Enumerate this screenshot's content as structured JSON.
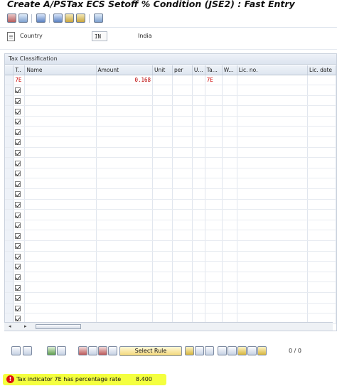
{
  "window": {
    "title": "Create A/PSTax ECS Setoff % Condition (JSE2) : Fast Entry"
  },
  "toolbar": {
    "icons": [
      "execute-icon",
      "variants-icon",
      "display-icon",
      "info-icon",
      "hierarchy-icon",
      "key-icon",
      "other-icon"
    ]
  },
  "country": {
    "label": "Country",
    "code": "IN",
    "name": "India"
  },
  "panel": {
    "title": "Tax Classification"
  },
  "table": {
    "columns": [
      "T..",
      "Name",
      "Amount",
      "Unit",
      "per",
      "U...",
      "Ta...",
      "W...",
      "Lic. no.",
      "Lic. date"
    ],
    "first_row": {
      "type": "7E",
      "amount": "0.168",
      "tax": "7E"
    },
    "row_count": 24
  },
  "buttons": {
    "select_rule": "Select Rule"
  },
  "counter": "0 / 0",
  "status": {
    "message": "Tax indicator 7E has percentage rate",
    "value": "8.400",
    "icon": "error-icon",
    "highlight_color": "#f4ff3f"
  },
  "colors": {
    "accent": "#c00000",
    "header": "#dee6f0"
  }
}
